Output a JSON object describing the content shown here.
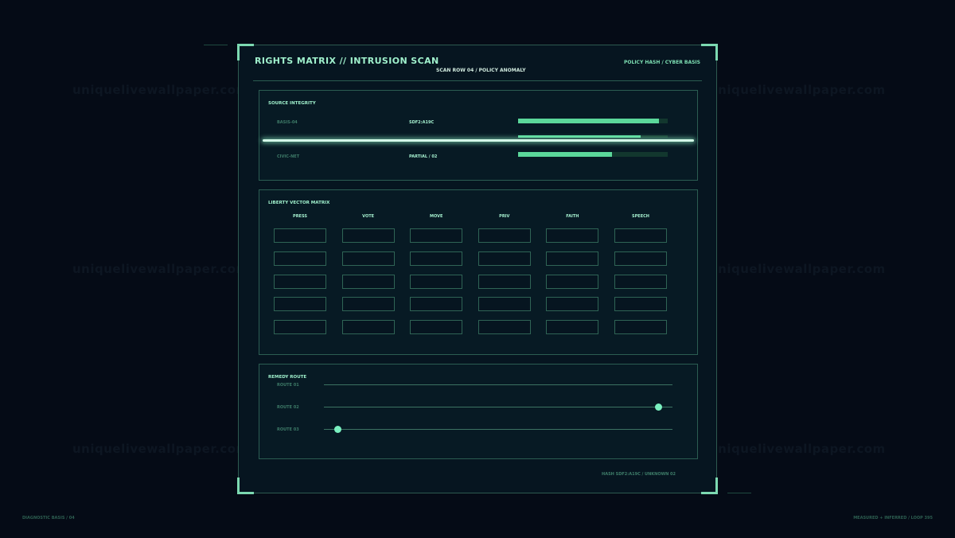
{
  "watermark_text": "uniquelivewallpaper.com",
  "header": {
    "title": "RIGHTS MATRIX // INTRUSION SCAN",
    "subtitle": "SCAN ROW 04 / POLICY ANOMALY",
    "right_label": "POLICY HASH / CYBER BASIS"
  },
  "source_integrity": {
    "title": "SOURCE INTEGRITY",
    "rows": [
      {
        "label": "BASIS-04",
        "value": "SDF2:A19C",
        "progress": 0.94
      },
      {
        "label": "",
        "value": "",
        "progress": 0.82
      },
      {
        "label": "CIVIC-NET",
        "value": "PARTIAL / 02",
        "progress": 0.63
      }
    ]
  },
  "liberty_matrix": {
    "title": "LIBERTY VECTOR MATRIX",
    "columns": [
      "PRESS",
      "VOTE",
      "MOVE",
      "PRIV",
      "FAITH",
      "SPEECH"
    ],
    "row_count": 5
  },
  "remedy_route": {
    "title": "REMEDY ROUTE",
    "routes": [
      {
        "label": "ROUTE 01",
        "knob": null
      },
      {
        "label": "ROUTE 02",
        "knob": 0.96
      },
      {
        "label": "ROUTE 03",
        "knob": 0.04
      }
    ]
  },
  "footer_hash": "HASH SDF2:A19C / UNKNOWN 02",
  "page_footer": {
    "left": "DIAGNOSTIC BASIS / 04",
    "right": "MEASURED + INFERRED / LOOP 395"
  },
  "colors": {
    "background": "#050b16",
    "accent": "#7cd9b1",
    "bar_fill": "#5bd79a"
  }
}
